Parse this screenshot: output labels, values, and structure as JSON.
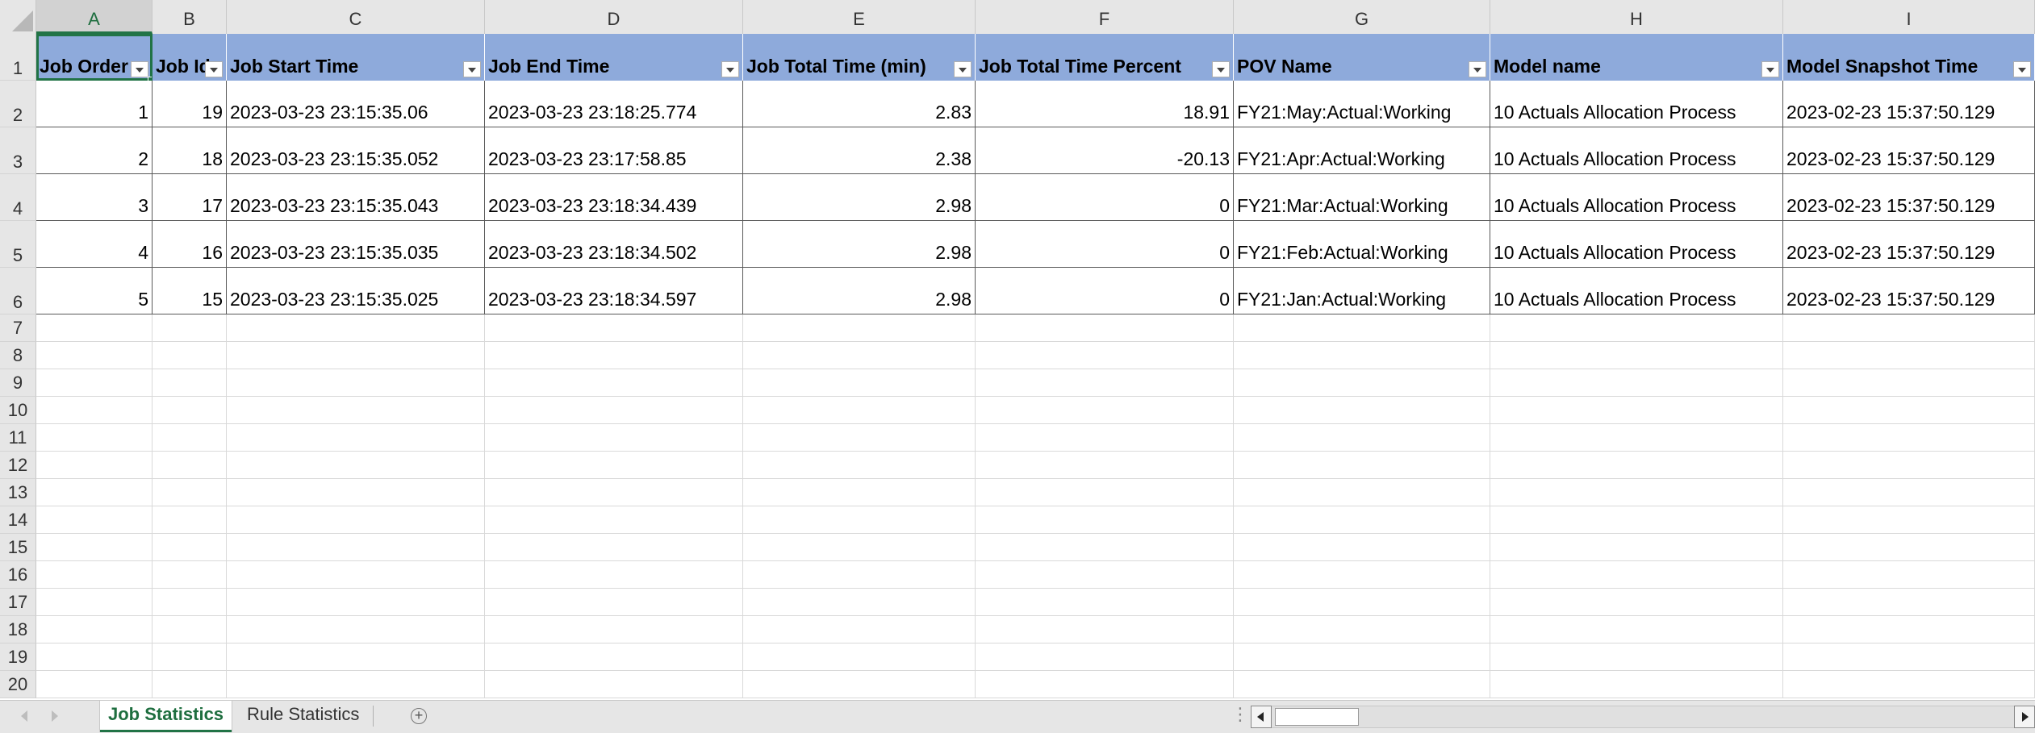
{
  "columns": [
    "A",
    "B",
    "C",
    "D",
    "E",
    "F",
    "G",
    "H",
    "I"
  ],
  "row_numbers": [
    "1",
    "2",
    "3",
    "4",
    "5",
    "6",
    "7",
    "8",
    "9",
    "10",
    "11",
    "12",
    "13",
    "14",
    "15",
    "16",
    "17",
    "18",
    "19",
    "20"
  ],
  "table": {
    "headers": [
      "Job Order",
      "Job Id",
      "Job Start Time",
      "Job End Time",
      "Job Total Time (min)",
      "Job Total Time Percent",
      "POV Name",
      "Model name",
      "Model Snapshot Time"
    ],
    "rows": [
      [
        "1",
        "19",
        "2023-03-23 23:15:35.06",
        "2023-03-23 23:18:25.774",
        "2.83",
        "18.91",
        "FY21:May:Actual:Working",
        "10 Actuals Allocation Process",
        "2023-02-23 15:37:50.129"
      ],
      [
        "2",
        "18",
        "2023-03-23 23:15:35.052",
        "2023-03-23 23:17:58.85",
        "2.38",
        "-20.13",
        "FY21:Apr:Actual:Working",
        "10 Actuals Allocation Process",
        "2023-02-23 15:37:50.129"
      ],
      [
        "3",
        "17",
        "2023-03-23 23:15:35.043",
        "2023-03-23 23:18:34.439",
        "2.98",
        "0",
        "FY21:Mar:Actual:Working",
        "10 Actuals Allocation Process",
        "2023-02-23 15:37:50.129"
      ],
      [
        "4",
        "16",
        "2023-03-23 23:15:35.035",
        "2023-03-23 23:18:34.502",
        "2.98",
        "0",
        "FY21:Feb:Actual:Working",
        "10 Actuals Allocation Process",
        "2023-02-23 15:37:50.129"
      ],
      [
        "5",
        "15",
        "2023-03-23 23:15:35.025",
        "2023-03-23 23:18:34.597",
        "2.98",
        "0",
        "FY21:Jan:Actual:Working",
        "10 Actuals Allocation Process",
        "2023-02-23 15:37:50.129"
      ]
    ]
  },
  "sheet_tabs": [
    "Job Statistics",
    "Rule Statistics"
  ],
  "active_tab": "Job Statistics",
  "selected_cell": "A1",
  "colors": {
    "header_fill": "#8eaadb",
    "accent": "#217346",
    "grid": "#d9d9d9"
  },
  "icons": {
    "filter": "filter-dropdown-icon",
    "add_sheet": "plus-circle-icon",
    "scroll_left": "chevron-left-icon",
    "scroll_right": "chevron-right-icon"
  }
}
